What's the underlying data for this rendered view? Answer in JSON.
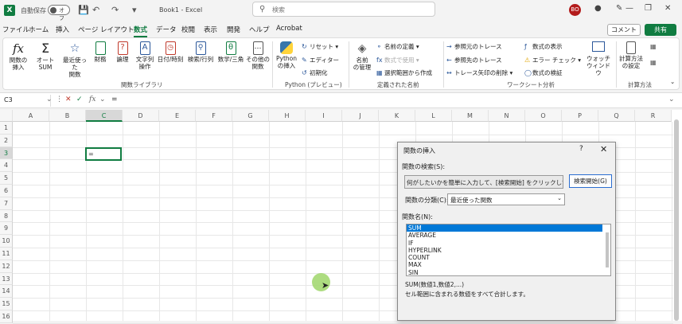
{
  "titlebar": {
    "logo": "X",
    "autosave_label": "自動保存",
    "autosave_state": "オフ",
    "doc_title": "Book1 - Excel",
    "search_placeholder": "検索",
    "user_initials": "BO",
    "icons": [
      "save-icon",
      "undo-icon",
      "redo-icon",
      "customize-icon",
      "lightbulb-icon",
      "pen-icon",
      "minimize-icon",
      "restore-icon",
      "close-icon"
    ]
  },
  "menu": {
    "items": [
      "ファイル",
      "ホーム",
      "挿入",
      "ページ レイアウト",
      "数式",
      "データ",
      "校閲",
      "表示",
      "開発",
      "ヘルプ",
      "Acrobat"
    ],
    "active": "数式",
    "comment": "コメント",
    "share": "共有"
  },
  "ribbon": {
    "library": {
      "insert_fn": [
        "関数の",
        "挿入"
      ],
      "autosum": [
        "オート",
        "SUM"
      ],
      "recent": [
        "最近使った",
        "関数"
      ],
      "financial": "財務",
      "logical": "論理",
      "text": [
        "文字列",
        "操作"
      ],
      "datetime": "日付/時刻",
      "lookup": "検索/行列",
      "math": "数学/三角",
      "more": [
        "その他の",
        "関数"
      ],
      "group": "関数ライブラリ"
    },
    "python": {
      "insert": [
        "Python",
        "の挿入"
      ],
      "reset": "リセット",
      "editor": "エディター",
      "init": "初期化",
      "group": "Python (プレビュー)"
    },
    "names": {
      "manager": [
        "名前",
        "の管理"
      ],
      "define": "名前の定義",
      "use": "数式で使用",
      "create": "選択範囲から作成",
      "group": "定義された名前"
    },
    "audit": {
      "trace_prec": "参照元のトレース",
      "trace_dep": "参照先のトレース",
      "remove_arrows": "トレース矢印の削除",
      "show_formulas": "数式の表示",
      "error_check": "エラー チェック",
      "evaluate": "数式の検証",
      "watch": [
        "ウォッチ",
        "ウィンドウ"
      ],
      "group": "ワークシート分析"
    },
    "calc": {
      "options": [
        "計算方法",
        "の設定"
      ],
      "group": "計算方法"
    }
  },
  "formula_bar": {
    "name_box": "C3",
    "fx": "fx",
    "value": "="
  },
  "sheet": {
    "columns": [
      "A",
      "B",
      "C",
      "D",
      "E",
      "F",
      "G",
      "H",
      "I",
      "J",
      "K",
      "L",
      "M",
      "N",
      "O",
      "P",
      "Q",
      "R"
    ],
    "rows": [
      "1",
      "2",
      "3",
      "4",
      "5",
      "6",
      "7",
      "8",
      "9",
      "10",
      "11",
      "12",
      "13",
      "14",
      "15",
      "16"
    ],
    "active_cell_value": "="
  },
  "dialog": {
    "title": "関数の挿入",
    "help": "?",
    "close": "✕",
    "search_label": "関数の検索(S):",
    "search_value": "何がしたいかを簡単に入力して、[検索開始] をクリックしてください。",
    "search_button": "検索開始(G)",
    "category_label": "関数の分類(C):",
    "category_value": "最近使った関数",
    "list_label": "関数名(N):",
    "functions": [
      "SUM",
      "AVERAGE",
      "IF",
      "HYPERLINK",
      "COUNT",
      "MAX",
      "SIN"
    ],
    "selected": "SUM",
    "syntax": "SUM(数値1,数値2,...)",
    "description": "セル範囲に含まれる数値をすべて合計します。"
  }
}
